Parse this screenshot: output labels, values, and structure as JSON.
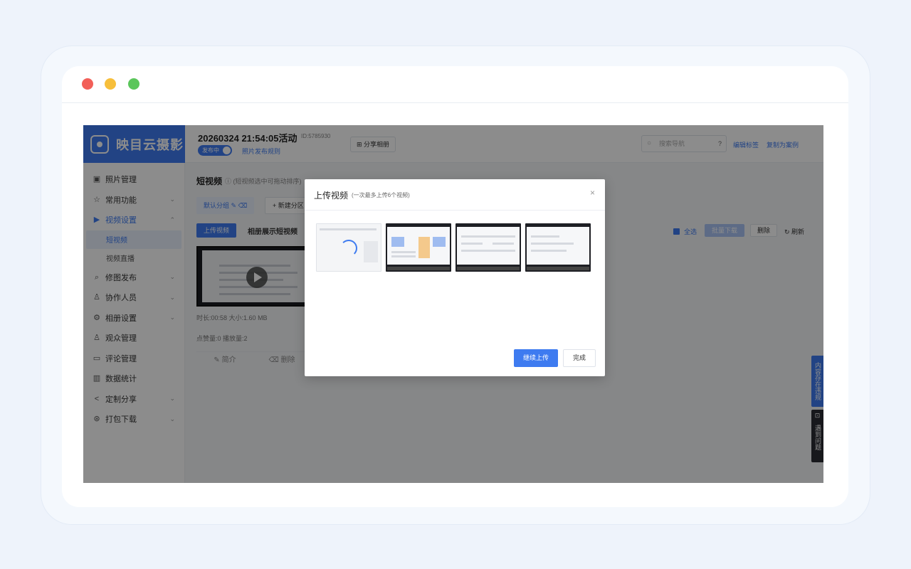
{
  "app": {
    "logo_text": "映目云摄影",
    "event_title": "20260324 21:54:05活动",
    "event_id": "ID:5785930",
    "status_toggle": "发布中",
    "publish_rule_link": "照片发布规则",
    "share_album": "分享相册",
    "search_placeholder": "搜索导航",
    "edit_tags": "编辑标签",
    "copy_as_case": "复制为案例"
  },
  "sidebar": {
    "items": [
      {
        "label": "照片管理",
        "icon": "image-icon"
      },
      {
        "label": "常用功能",
        "icon": "star-icon"
      },
      {
        "label": "视频设置",
        "icon": "video-icon"
      },
      {
        "label": "短视频",
        "icon": ""
      },
      {
        "label": "视频直播",
        "icon": ""
      },
      {
        "label": "修图发布",
        "icon": "retouch-icon"
      },
      {
        "label": "协作人员",
        "icon": "user-icon"
      },
      {
        "label": "相册设置",
        "icon": "settings-icon"
      },
      {
        "label": "观众管理",
        "icon": "audience-icon"
      },
      {
        "label": "评论管理",
        "icon": "comment-icon"
      },
      {
        "label": "数据统计",
        "icon": "stats-icon"
      },
      {
        "label": "定制分享",
        "icon": "share-icon"
      },
      {
        "label": "打包下载",
        "icon": "download-icon"
      }
    ]
  },
  "content": {
    "section_title": "短视频",
    "section_hint": "(短视频选中可拖动排序)",
    "default_group": "默认分组",
    "new_group": "新建分区",
    "upload_video": "上传视频",
    "album_label": "相册展示短视频",
    "video": {
      "duration": "时长:00:58",
      "size": "大小:1.60 MB",
      "likes": "点赞量:0",
      "plays": "播放量:2",
      "intro": "简介",
      "delete": "删除"
    },
    "select_all": "全选",
    "batch_download": "批量下载",
    "delete": "删除",
    "refresh": "刷新"
  },
  "float": {
    "violation": "内容存在违规",
    "problem": "遇到问题"
  },
  "modal": {
    "title": "上传视频",
    "subtitle": "(一次最多上传6个视频)",
    "continue_upload": "继续上传",
    "done": "完成"
  },
  "colors": {
    "accent": "#3e7bf0",
    "mask": "rgba(0,0,0,0.45)"
  }
}
